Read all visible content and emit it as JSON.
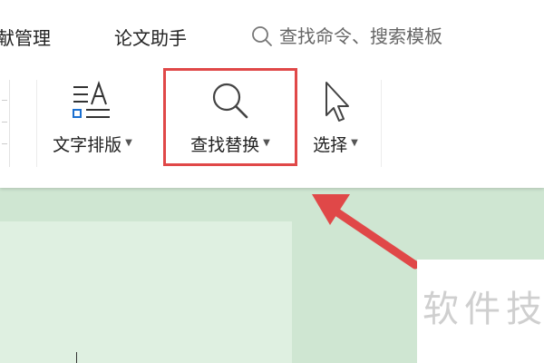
{
  "tabs": [
    {
      "label": "献管理"
    },
    {
      "label": "论文助手"
    }
  ],
  "search": {
    "placeholder": "查找命令、搜索模板"
  },
  "toolbar": {
    "text_layout": {
      "label": "文字排版",
      "icon": "text-layout-icon"
    },
    "find_replace": {
      "label": "查找替换",
      "icon": "magnifier-icon"
    },
    "select": {
      "label": "选择",
      "icon": "cursor-arrow-icon"
    }
  },
  "annotation": {
    "color": "#e04848"
  },
  "watermark": {
    "text": "软件技"
  }
}
